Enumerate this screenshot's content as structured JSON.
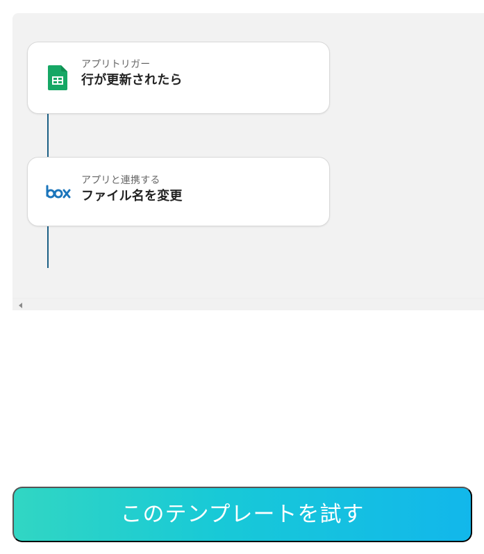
{
  "flow": {
    "steps": [
      {
        "subtitle": "アプリトリガー",
        "title": "行が更新されたら",
        "icon": "google-sheets-icon"
      },
      {
        "subtitle": "アプリと連携する",
        "title": "ファイル名を変更",
        "icon": "box-logo-icon"
      }
    ],
    "colors": {
      "canvas_background": "#f2f2f2",
      "connector": "#1b5f85",
      "sheets_green": "#16a765",
      "box_blue": "#1b75bb"
    }
  },
  "cta": {
    "label": "このテンプレートを試す",
    "gradient_start": "#31d6c3",
    "gradient_end": "#12b7eb"
  },
  "scrollbar": {
    "left_arrow_icon": "scroll-left-arrow-icon"
  }
}
